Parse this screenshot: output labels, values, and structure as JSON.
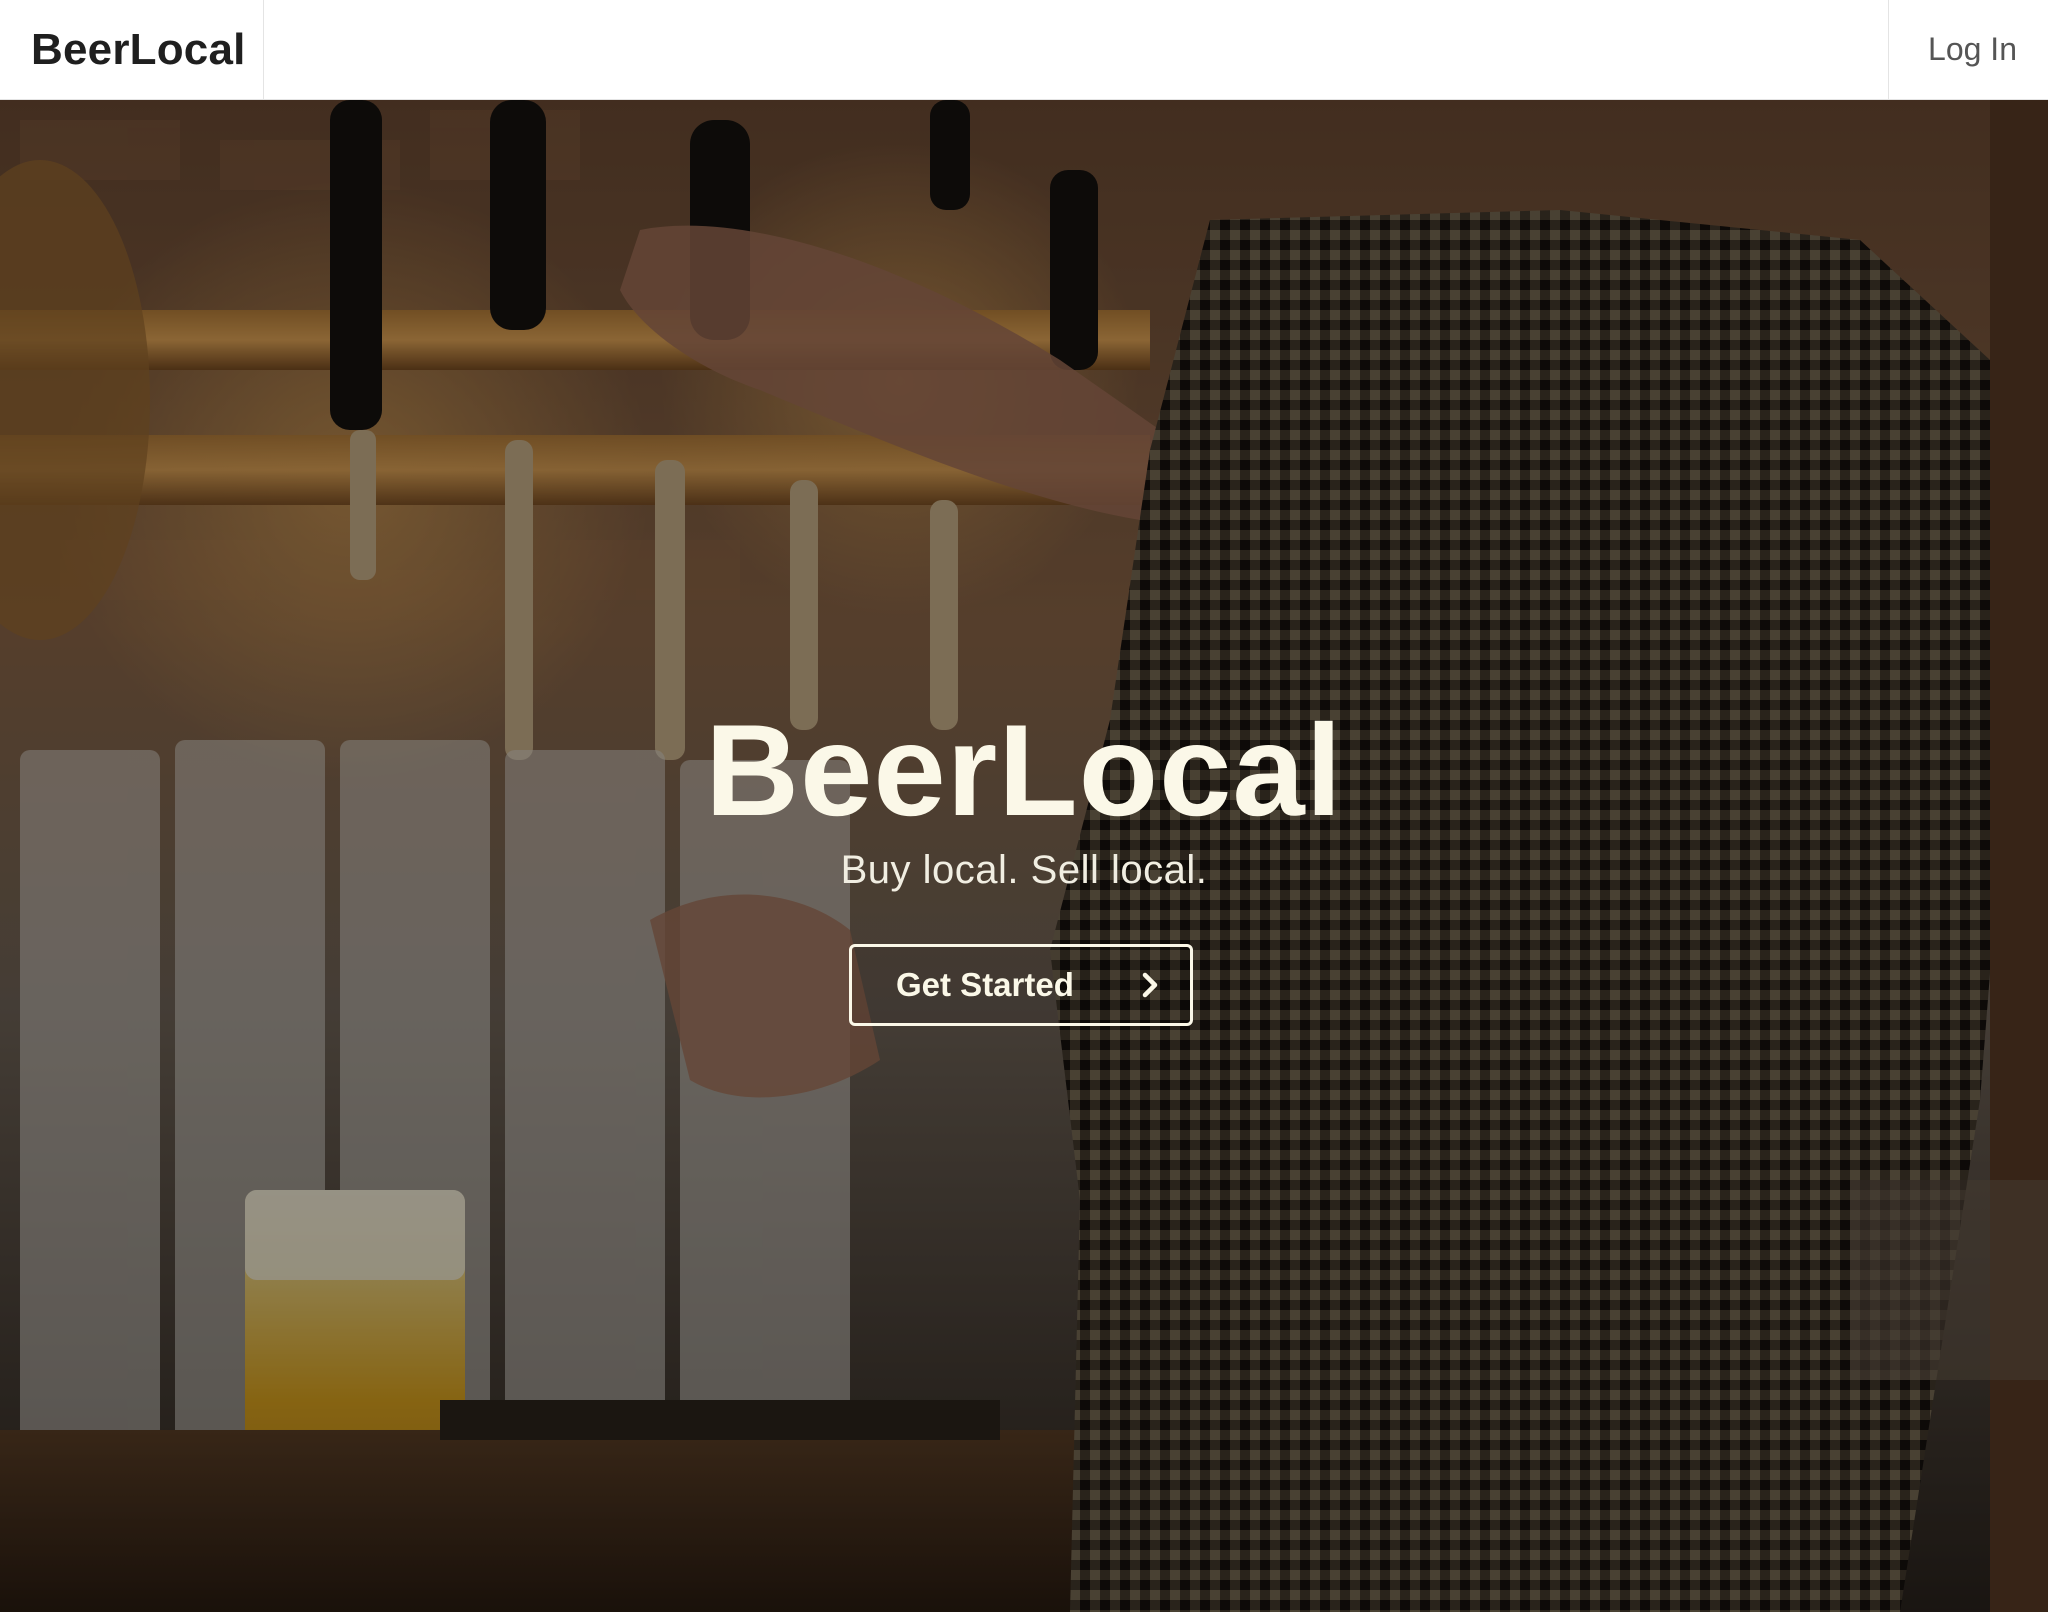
{
  "navbar": {
    "brand": "BeerLocal",
    "login_label": "Log In"
  },
  "hero": {
    "title": "BeerLocal",
    "tagline": "Buy local. Sell local.",
    "cta_label": "Get Started",
    "cta_icon": "chevron-right-icon",
    "background_image": "bartender pouring beer from tap, dimmed"
  },
  "colors": {
    "hero_text": "#fbf8e8",
    "brand_text": "#1f1f1f",
    "login_text": "#555555",
    "nav_border": "#e4e4e4"
  }
}
